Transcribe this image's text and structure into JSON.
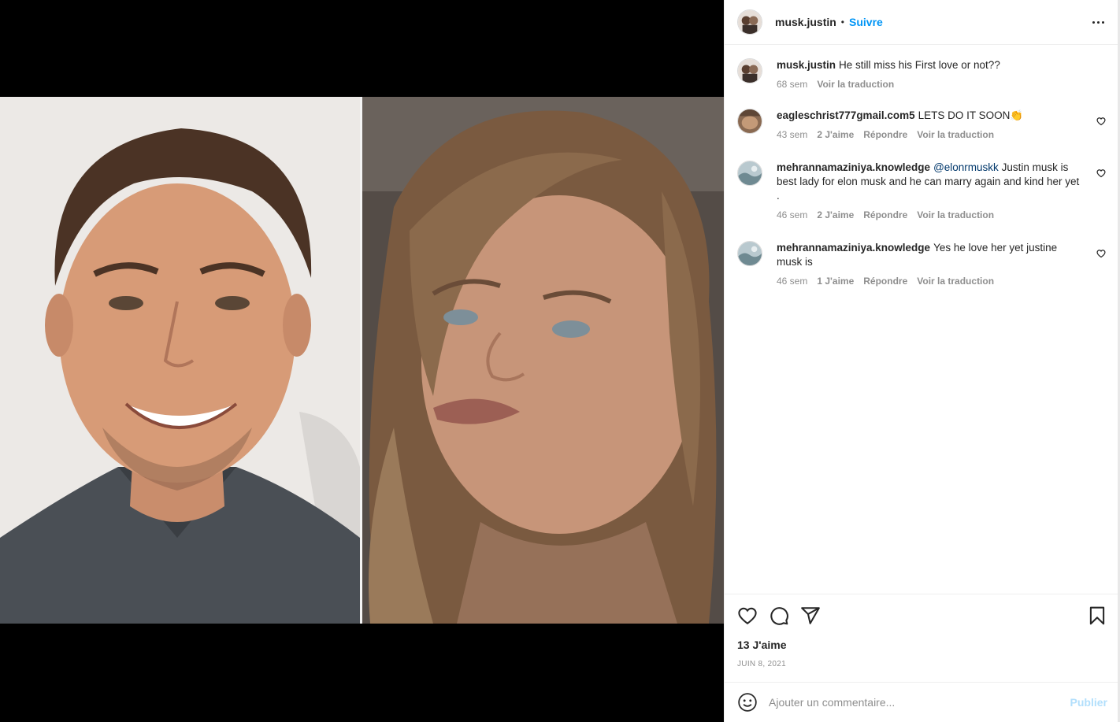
{
  "post": {
    "author": "musk.justin",
    "separator": "•",
    "follow_label": "Suivre",
    "caption": {
      "user": "musk.justin",
      "text": "He still miss his First love or not??",
      "age": "68 sem",
      "translate_label": "Voir la traduction"
    },
    "likes_label": "13 J'aime",
    "date": "JUIN 8, 2021"
  },
  "comments": [
    {
      "user": "eagleschrist777gmail.com5",
      "mention": "",
      "text": "LETS DO IT SOON👏",
      "age": "43 sem",
      "likes": "2 J'aime",
      "reply_label": "Répondre",
      "translate_label": "Voir la traduction"
    },
    {
      "user": "mehrannamaziniya.knowledge",
      "mention": "@elonrmuskk",
      "text": "Justin musk is best lady for elon musk and he can marry again and kind her yet .",
      "age": "46 sem",
      "likes": "2 J'aime",
      "reply_label": "Répondre",
      "translate_label": "Voir la traduction"
    },
    {
      "user": "mehrannamaziniya.knowledge",
      "mention": "",
      "text": "Yes he love her yet justine musk is",
      "age": "46 sem",
      "likes": "1 J'aime",
      "reply_label": "Répondre",
      "translate_label": "Voir la traduction"
    }
  ],
  "add_comment": {
    "placeholder": "Ajouter un commentaire...",
    "publish_label": "Publier"
  },
  "icons": [
    "heart-icon",
    "comment-icon",
    "share-icon",
    "bookmark-icon",
    "emoji-icon",
    "more-icon"
  ],
  "colors": {
    "accent": "#0095f6",
    "publish_disabled": "#b2dffc",
    "muted": "#8e8e8e",
    "mention": "#00376b"
  }
}
